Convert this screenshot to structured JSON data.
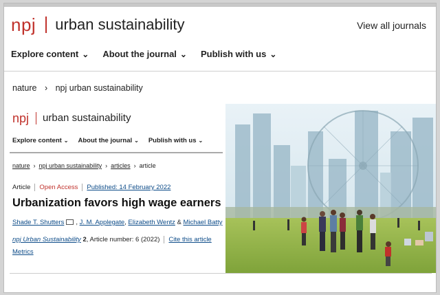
{
  "header": {
    "brand": "npj",
    "journal": "urban sustainability",
    "view_all": "View all journals"
  },
  "nav": [
    {
      "label": "Explore content"
    },
    {
      "label": "About the journal"
    },
    {
      "label": "Publish with us"
    }
  ],
  "breadcrumb": {
    "items": [
      "nature",
      "npj urban sustainability"
    ]
  },
  "inner": {
    "brand": "npj",
    "journal": "urban sustainability",
    "nav": [
      "Explore content",
      "About the journal",
      "Publish with us"
    ],
    "breadcrumb": [
      "nature",
      "npj urban sustainability",
      "articles",
      "article"
    ],
    "article_type": "Article",
    "access": "Open Access",
    "published": "Published: 14 February 2022",
    "title": "Urbanization favors high wage earners",
    "authors": [
      "Shade T. Shutters",
      "J. M. Applegate",
      "Elizabeth Wentz",
      "Michael Batty"
    ],
    "author_sep": ",",
    "and": "&",
    "journal_cite": "npj Urban Sustainability",
    "volume": "2",
    "article_number": ", Article number: 6 (2022)",
    "cite_link": "Cite this article",
    "metrics": "Metrics"
  },
  "colors": {
    "accent": "#c0312b",
    "link": "#0c4b88"
  }
}
